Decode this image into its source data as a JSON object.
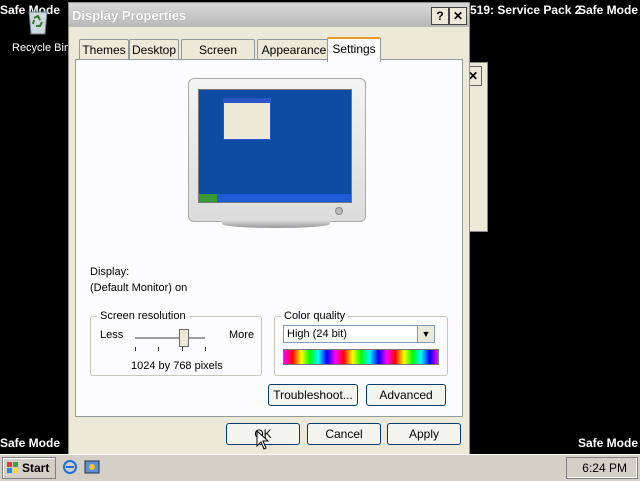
{
  "desktop": {
    "safe_mode": "Safe Mode",
    "build_text": "519: Service Pack 2",
    "recycle_bin_label": "Recycle Bin"
  },
  "dialog": {
    "title": "Display Properties",
    "help_glyph": "?",
    "close_glyph": "✕",
    "tabs": [
      {
        "label": "Themes"
      },
      {
        "label": "Desktop"
      },
      {
        "label": "Screen Saver"
      },
      {
        "label": "Appearance"
      },
      {
        "label": "Settings"
      }
    ],
    "active_tab": "Settings",
    "settings": {
      "display_label": "Display:",
      "display_value": "(Default Monitor) on",
      "resolution": {
        "title": "Screen resolution",
        "less": "Less",
        "more": "More",
        "value": "1024 by 768 pixels"
      },
      "color": {
        "title": "Color quality",
        "selected": "High (24 bit)"
      },
      "troubleshoot_label": "Troubleshoot...",
      "advanced_label": "Advanced"
    },
    "buttons": {
      "ok": "OK",
      "cancel": "Cancel",
      "apply": "Apply"
    }
  },
  "taskbar": {
    "start_label": "Start",
    "clock": "6:24 PM"
  },
  "colors": {
    "desktop_bg": "#000000",
    "dialog_bg": "#ece9d8",
    "monitor_screen": "#0d4ca3",
    "active_tab_accent": "#e69b2a"
  }
}
